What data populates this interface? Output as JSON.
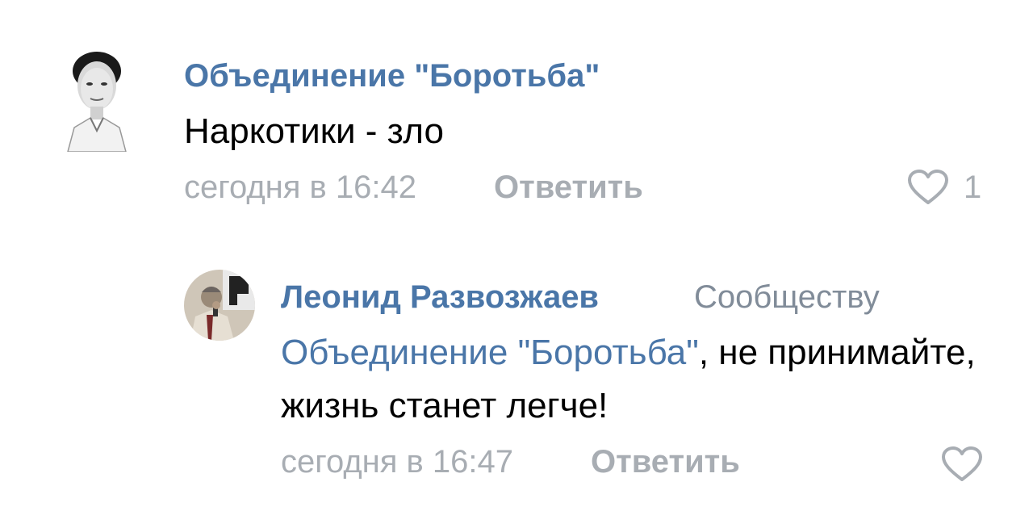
{
  "comments": [
    {
      "author": "Объединение \"Боротьба\"",
      "text": "Наркотики - зло",
      "time": "сегодня в 16:42",
      "reply_label": "Ответить",
      "likes": "1"
    },
    {
      "author": "Леонид Развозжаев",
      "reply_to_label": "Сообществу",
      "mention": "Объединение \"Боротьба\"",
      "text_rest": ", не принимайте, жизнь станет легче!",
      "time": "сегодня в 16:47",
      "reply_label": "Ответить"
    }
  ],
  "colors": {
    "link": "#4a76a8",
    "secondary": "#a8adb3",
    "text": "#000000"
  },
  "icons": {
    "like": "heart-outline-icon"
  }
}
